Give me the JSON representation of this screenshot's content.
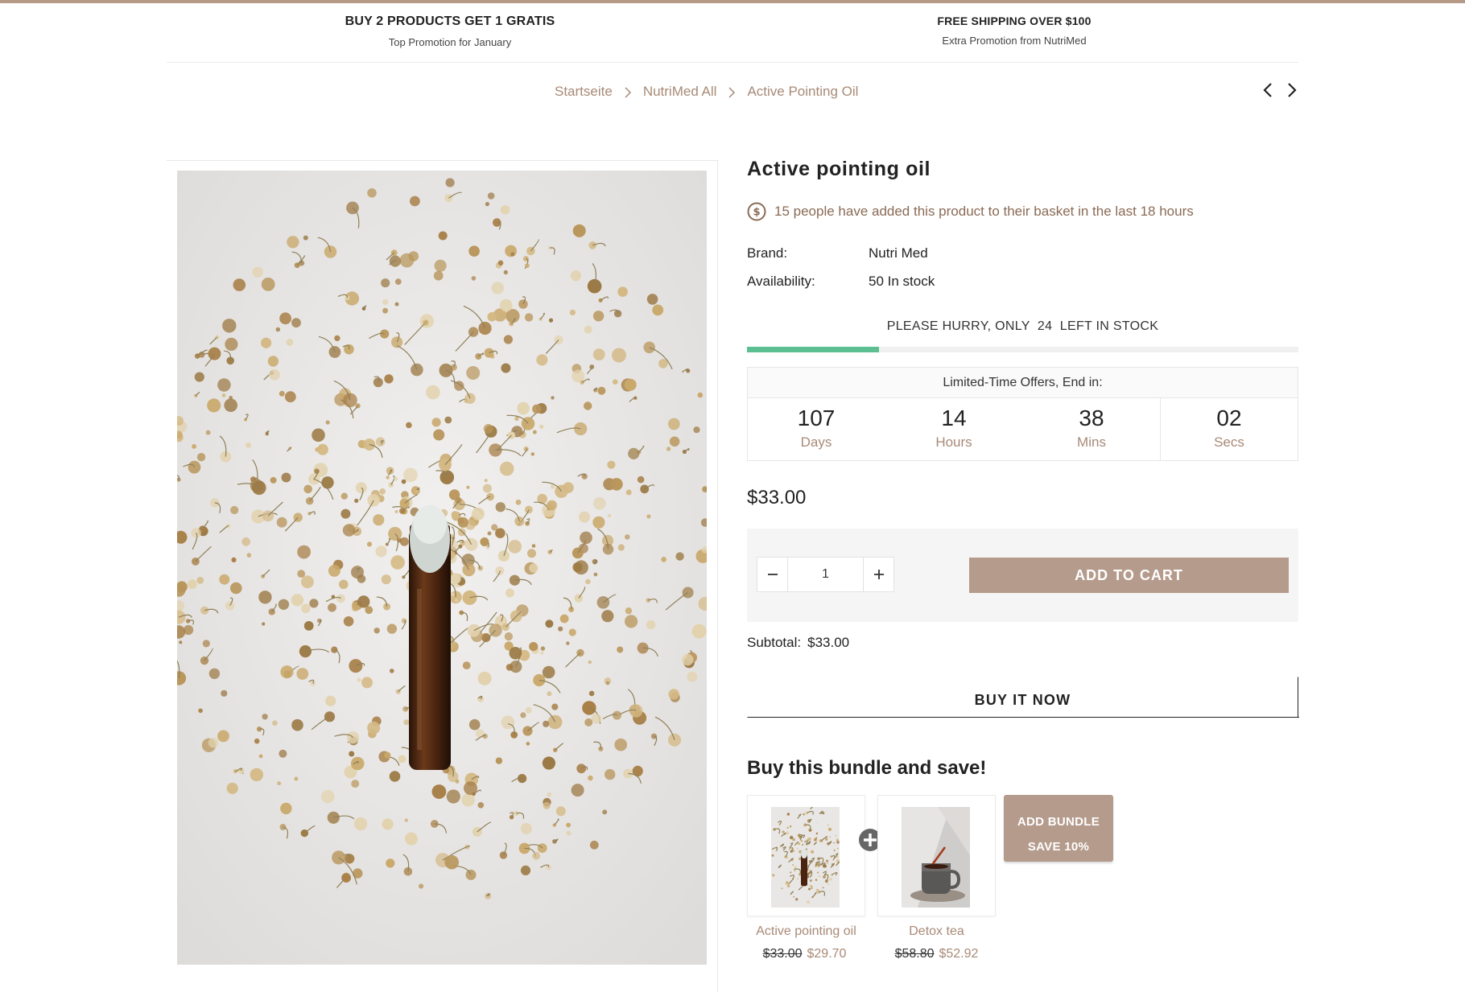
{
  "promos": [
    {
      "title": "BUY 2 PRODUCTS GET 1 GRATIS",
      "subtitle": "Top Promotion for January"
    },
    {
      "title": "FREE SHIPPING OVER $100",
      "subtitle": "Extra Promotion from NutriMed"
    }
  ],
  "breadcrumb": [
    "Startseite",
    "NutriMed All",
    "Active Pointing Oil"
  ],
  "product": {
    "title": "Active pointing oil",
    "social_proof": "15 people have added this product to their basket in the last 18 hours",
    "brand_label": "Brand:",
    "brand_value": "Nutri Med",
    "availability_label": "Availability:",
    "availability_value": "50 In stock",
    "hurry_text": "PLEASE HURRY, ONLY  24  LEFT IN STOCK",
    "stock_fill_fraction": 0.24,
    "price": "$33.00",
    "quantity": "1",
    "add_to_cart": "ADD TO CART",
    "subtotal_label": "Subtotal:",
    "subtotal_value": "$33.00",
    "buy_now": "BUY IT NOW"
  },
  "countdown": {
    "header": "Limited-Time Offers, End in:",
    "units": [
      {
        "value": "107",
        "label": "Days"
      },
      {
        "value": "14",
        "label": "Hours"
      },
      {
        "value": "38",
        "label": "Mins"
      },
      {
        "value": "02",
        "label": "Secs"
      }
    ]
  },
  "bundle": {
    "title": "Buy this bundle and save!",
    "items": [
      {
        "name": "Active pointing oil",
        "old_price": "$33.00",
        "new_price": "$29.70"
      },
      {
        "name": "Detox tea",
        "old_price": "$58.80",
        "new_price": "$52.92"
      }
    ],
    "button_line1": "ADD BUNDLE",
    "button_line2": "SAVE 10%"
  },
  "colors": {
    "accent": "#b59b8c",
    "link": "#a88a77",
    "stock_bar": "#5cbf91"
  },
  "icons": [
    "dollar-circle-icon",
    "chevron-left-icon",
    "chevron-right-icon",
    "minus-icon",
    "plus-icon",
    "plus-circle-icon",
    "chevron-right-separator-icon"
  ]
}
